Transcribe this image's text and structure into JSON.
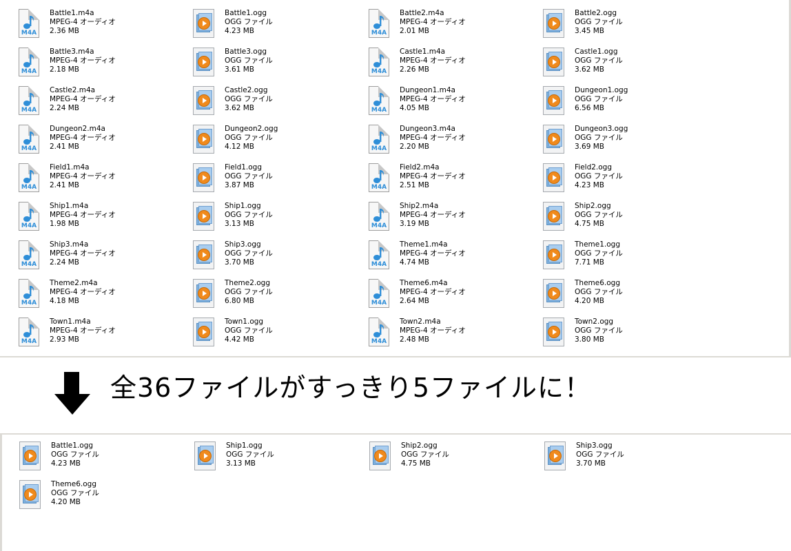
{
  "top_files": [
    {
      "name": "Battle1.m4a",
      "type": "MPEG-4 オーディオ",
      "size": "2.36 MB",
      "icon": "m4a"
    },
    {
      "name": "Battle1.ogg",
      "type": "OGG ファイル",
      "size": "4.23 MB",
      "icon": "ogg"
    },
    {
      "name": "Battle2.m4a",
      "type": "MPEG-4 オーディオ",
      "size": "2.01 MB",
      "icon": "m4a"
    },
    {
      "name": "Battle2.ogg",
      "type": "OGG ファイル",
      "size": "3.45 MB",
      "icon": "ogg"
    },
    {
      "name": "Battle3.m4a",
      "type": "MPEG-4 オーディオ",
      "size": "2.18 MB",
      "icon": "m4a"
    },
    {
      "name": "Battle3.ogg",
      "type": "OGG ファイル",
      "size": "3.61 MB",
      "icon": "ogg"
    },
    {
      "name": "Castle1.m4a",
      "type": "MPEG-4 オーディオ",
      "size": "2.26 MB",
      "icon": "m4a"
    },
    {
      "name": "Castle1.ogg",
      "type": "OGG ファイル",
      "size": "3.62 MB",
      "icon": "ogg"
    },
    {
      "name": "Castle2.m4a",
      "type": "MPEG-4 オーディオ",
      "size": "2.24 MB",
      "icon": "m4a"
    },
    {
      "name": "Castle2.ogg",
      "type": "OGG ファイル",
      "size": "3.62 MB",
      "icon": "ogg"
    },
    {
      "name": "Dungeon1.m4a",
      "type": "MPEG-4 オーディオ",
      "size": "4.05 MB",
      "icon": "m4a"
    },
    {
      "name": "Dungeon1.ogg",
      "type": "OGG ファイル",
      "size": "6.56 MB",
      "icon": "ogg"
    },
    {
      "name": "Dungeon2.m4a",
      "type": "MPEG-4 オーディオ",
      "size": "2.41 MB",
      "icon": "m4a"
    },
    {
      "name": "Dungeon2.ogg",
      "type": "OGG ファイル",
      "size": "4.12 MB",
      "icon": "ogg"
    },
    {
      "name": "Dungeon3.m4a",
      "type": "MPEG-4 オーディオ",
      "size": "2.20 MB",
      "icon": "m4a"
    },
    {
      "name": "Dungeon3.ogg",
      "type": "OGG ファイル",
      "size": "3.69 MB",
      "icon": "ogg"
    },
    {
      "name": "Field1.m4a",
      "type": "MPEG-4 オーディオ",
      "size": "2.41 MB",
      "icon": "m4a"
    },
    {
      "name": "Field1.ogg",
      "type": "OGG ファイル",
      "size": "3.87 MB",
      "icon": "ogg"
    },
    {
      "name": "Field2.m4a",
      "type": "MPEG-4 オーディオ",
      "size": "2.51 MB",
      "icon": "m4a"
    },
    {
      "name": "Field2.ogg",
      "type": "OGG ファイル",
      "size": "4.23 MB",
      "icon": "ogg"
    },
    {
      "name": "Ship1.m4a",
      "type": "MPEG-4 オーディオ",
      "size": "1.98 MB",
      "icon": "m4a"
    },
    {
      "name": "Ship1.ogg",
      "type": "OGG ファイル",
      "size": "3.13 MB",
      "icon": "ogg"
    },
    {
      "name": "Ship2.m4a",
      "type": "MPEG-4 オーディオ",
      "size": "3.19 MB",
      "icon": "m4a"
    },
    {
      "name": "Ship2.ogg",
      "type": "OGG ファイル",
      "size": "4.75 MB",
      "icon": "ogg"
    },
    {
      "name": "Ship3.m4a",
      "type": "MPEG-4 オーディオ",
      "size": "2.24 MB",
      "icon": "m4a"
    },
    {
      "name": "Ship3.ogg",
      "type": "OGG ファイル",
      "size": "3.70 MB",
      "icon": "ogg"
    },
    {
      "name": "Theme1.m4a",
      "type": "MPEG-4 オーディオ",
      "size": "4.74 MB",
      "icon": "m4a"
    },
    {
      "name": "Theme1.ogg",
      "type": "OGG ファイル",
      "size": "7.71 MB",
      "icon": "ogg"
    },
    {
      "name": "Theme2.m4a",
      "type": "MPEG-4 オーディオ",
      "size": "4.18 MB",
      "icon": "m4a"
    },
    {
      "name": "Theme2.ogg",
      "type": "OGG ファイル",
      "size": "6.80 MB",
      "icon": "ogg"
    },
    {
      "name": "Theme6.m4a",
      "type": "MPEG-4 オーディオ",
      "size": "2.64 MB",
      "icon": "m4a"
    },
    {
      "name": "Theme6.ogg",
      "type": "OGG ファイル",
      "size": "4.20 MB",
      "icon": "ogg"
    },
    {
      "name": "Town1.m4a",
      "type": "MPEG-4 オーディオ",
      "size": "2.93 MB",
      "icon": "m4a"
    },
    {
      "name": "Town1.ogg",
      "type": "OGG ファイル",
      "size": "4.42 MB",
      "icon": "ogg"
    },
    {
      "name": "Town2.m4a",
      "type": "MPEG-4 オーディオ",
      "size": "2.48 MB",
      "icon": "m4a"
    },
    {
      "name": "Town2.ogg",
      "type": "OGG ファイル",
      "size": "3.80 MB",
      "icon": "ogg"
    }
  ],
  "caption": "全36ファイルがすっきり5ファイルに！",
  "bottom_files": [
    {
      "name": "Battle1.ogg",
      "type": "OGG ファイル",
      "size": "4.23 MB",
      "icon": "ogg"
    },
    {
      "name": "Ship1.ogg",
      "type": "OGG ファイル",
      "size": "3.13 MB",
      "icon": "ogg"
    },
    {
      "name": "Ship2.ogg",
      "type": "OGG ファイル",
      "size": "4.75 MB",
      "icon": "ogg"
    },
    {
      "name": "Ship3.ogg",
      "type": "OGG ファイル",
      "size": "3.70 MB",
      "icon": "ogg"
    },
    {
      "name": "Theme6.ogg",
      "type": "OGG ファイル",
      "size": "4.20 MB",
      "icon": "ogg"
    }
  ],
  "icons": {
    "m4a": "m4a-file-icon",
    "ogg": "ogg-file-icon",
    "arrow": "down-arrow-icon"
  },
  "colors": {
    "m4a_label": "#2e8ed8",
    "ogg_play": "#f08a1c",
    "frame": "#dcdad5"
  },
  "m4a_badge": "M4A"
}
